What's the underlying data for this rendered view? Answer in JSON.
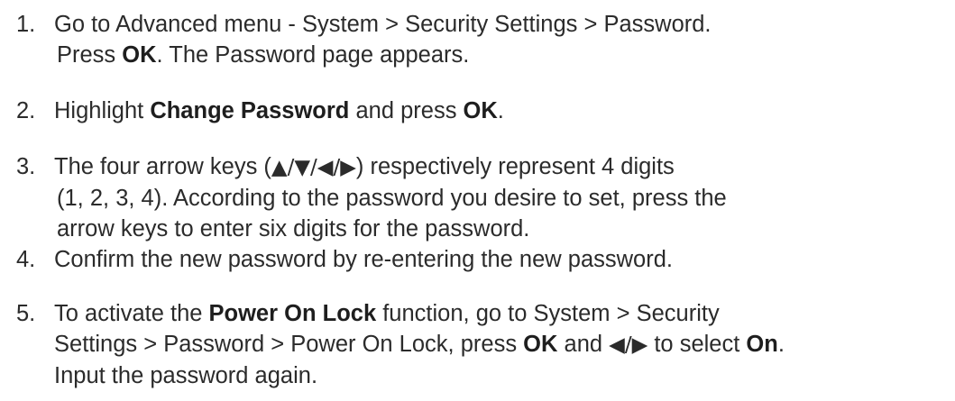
{
  "steps": [
    {
      "number": "1.",
      "lines": [
        [
          {
            "t": "Go to Advanced menu - System > Security Settings > Password."
          }
        ],
        [
          {
            "t": "Press "
          },
          {
            "t": "OK",
            "b": true
          },
          {
            "t": ". The Password page appears."
          }
        ]
      ]
    },
    {
      "number": "2.",
      "lines": [
        [
          {
            "t": "Highlight "
          },
          {
            "t": "Change Password",
            "b": true
          },
          {
            "t": " and press "
          },
          {
            "t": "OK",
            "b": true
          },
          {
            "t": "."
          }
        ]
      ]
    },
    {
      "number": "3.",
      "lines": [
        [
          {
            "t": "The four arrow keys ("
          },
          {
            "t": "▲/▼/◀/▶",
            "g": true
          },
          {
            "t": ") respectively represent 4 digits"
          }
        ],
        [
          {
            "t": "(1, 2, 3, 4). According to the password you desire to set, press the"
          }
        ],
        [
          {
            "t": "arrow keys to enter six digits for the password."
          }
        ]
      ]
    },
    {
      "number": "4.",
      "lines": [
        [
          {
            "t": "Confirm the new password by re-entering the new password."
          }
        ]
      ]
    },
    {
      "number": "5.",
      "lines": [
        [
          {
            "t": "To activate the "
          },
          {
            "t": "Power On Lock",
            "b": true
          },
          {
            "t": " function, go to System > Security"
          }
        ],
        [
          {
            "t": "Settings > Password > Power On Lock, press "
          },
          {
            "t": "OK",
            "b": true
          },
          {
            "t": " and "
          },
          {
            "t": "◀/▶",
            "g": true
          },
          {
            "t": " to select "
          },
          {
            "t": "On",
            "b": true
          },
          {
            "t": "."
          }
        ],
        [
          {
            "t": "Input the password again."
          }
        ]
      ]
    }
  ]
}
